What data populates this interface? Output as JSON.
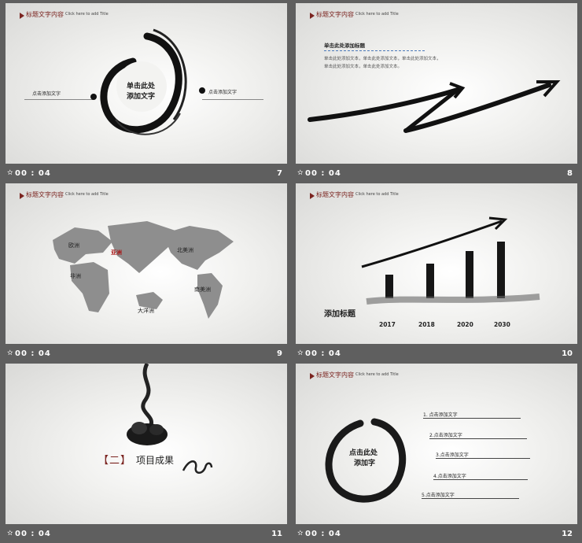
{
  "slides": [
    {
      "number": "7",
      "time": "00 : 04",
      "header": "标题文字内容",
      "header_sub": "Click here to add Title",
      "center_line1": "单击此处",
      "center_line2": "添加文字",
      "left_text": "点击添加文字",
      "right_text": "点击添加文字"
    },
    {
      "number": "8",
      "time": "00 : 04",
      "header": "标题文字内容",
      "header_sub": "Click here to add Title",
      "title": "单击此处添加标题",
      "body_line1": "单击此处添加文本，单击此处添加文本，单击此处添加文本，",
      "body_line2": "单击此处添加文本，单击此处添加文本。"
    },
    {
      "number": "9",
      "time": "00 : 04",
      "header": "标题文字内容",
      "header_sub": "Click here to add Title",
      "labels": {
        "europe": "欧洲",
        "asia": "亚洲",
        "north_america": "北美洲",
        "africa": "非洲",
        "south_america": "南美洲",
        "oceania": "大洋洲"
      }
    },
    {
      "number": "10",
      "time": "00 : 04",
      "header": "标题文字内容",
      "header_sub": "Click here to add Title",
      "title": "添加标题",
      "years": [
        "2017",
        "2018",
        "2020",
        "2030"
      ]
    },
    {
      "number": "11",
      "time": "00 : 04",
      "bracket_open": "【",
      "section_number": "二",
      "bracket_close": "】",
      "section_title": "项目成果"
    },
    {
      "number": "12",
      "time": "00 : 04",
      "header": "标题文字内容",
      "header_sub": "Click here to add Title",
      "center_line1": "点击此处",
      "center_line2": "添加字",
      "items": [
        "1. 点击添加文字",
        "2.点击添加文字",
        "3.点击添加文字",
        "4.点击添加文字",
        "5.点击添加文字"
      ]
    }
  ],
  "colors": {
    "accent": "#7b2420",
    "ink": "#111111",
    "map": "#8e8e8e",
    "background": "#5f5f5f"
  }
}
